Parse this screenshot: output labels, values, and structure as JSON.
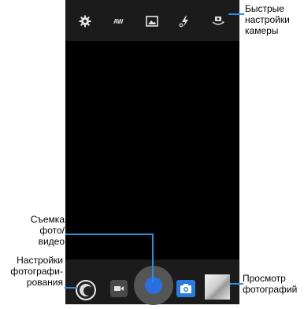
{
  "callouts": {
    "quick_settings": "Быстрые\nнастройки\nкамеры",
    "capture": "Съемка\nфото/видео",
    "photo_settings": "Настройки\nфотографи-\nрования",
    "gallery": "Просмотр\nфотографий"
  },
  "top_icons": [
    "gear-icon",
    "white-balance-icon",
    "scene-icon",
    "flash-auto-icon",
    "switch-camera-icon"
  ],
  "top_icon_labels": {
    "white_balance": "AW"
  },
  "bottom_icons": [
    "settings-lens-icon",
    "video-camera-icon",
    "shutter-button",
    "photo-mode-icon",
    "gallery-thumbnail"
  ],
  "colors": {
    "accent": "#2a6fe0",
    "callout_line": "#2a8fd6",
    "bar": "#1b1b1b",
    "viewfinder": "#000000"
  }
}
